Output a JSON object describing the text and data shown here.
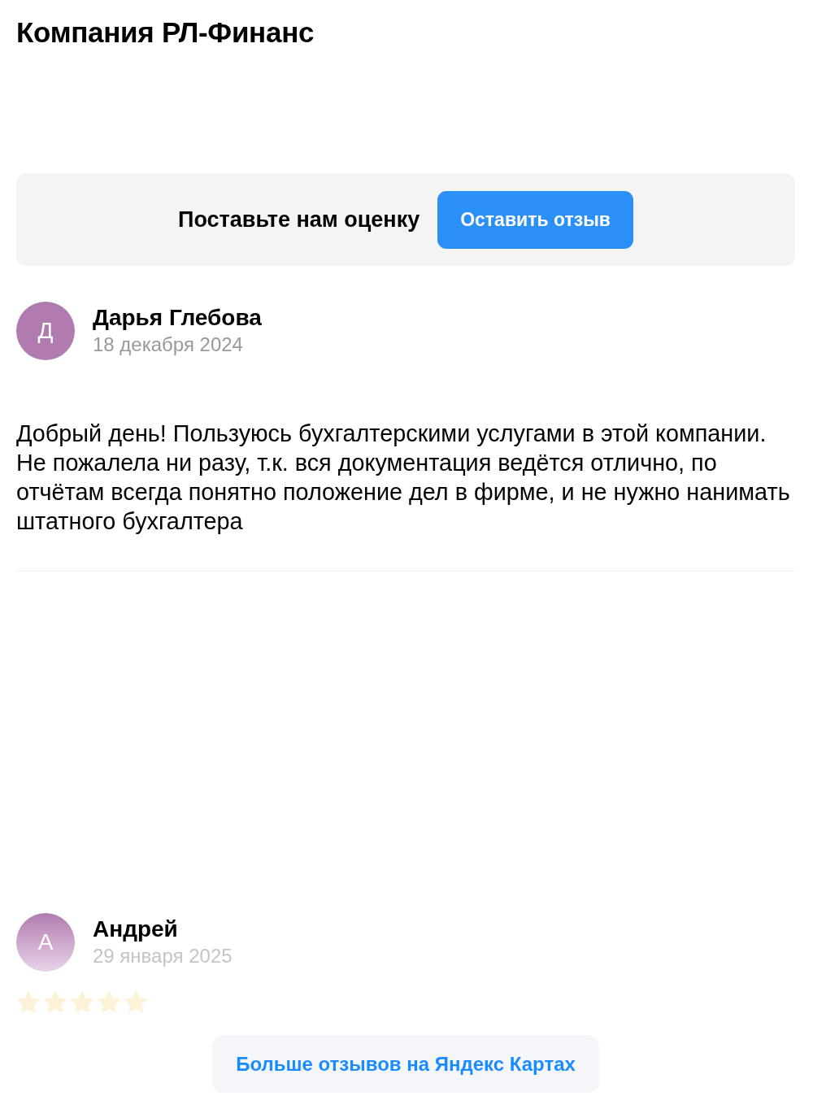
{
  "title": "Компания РЛ-Финанс",
  "rating_prompt": {
    "text": "Поставьте нам оценку",
    "button": "Оставить отзыв"
  },
  "reviews": [
    {
      "initial": "Д",
      "author": "Дарья Глебова",
      "date": "18 декабря 2024",
      "faded": false,
      "text": "Добрый день! Пользуюсь бухгалтерскими услугами в этой компании. Не пожалела ни разу, т.к. вся документация ведётся отлично, по отчётам всегда понятно положение дел в фирме, и не нужно нанимать штатного бухгалтера"
    },
    {
      "initial": "А",
      "author": "Андрей",
      "date": "29 января 2025",
      "faded": true,
      "stars": 5
    }
  ],
  "more_button": "Больше отзывов на Яндекс Картах"
}
